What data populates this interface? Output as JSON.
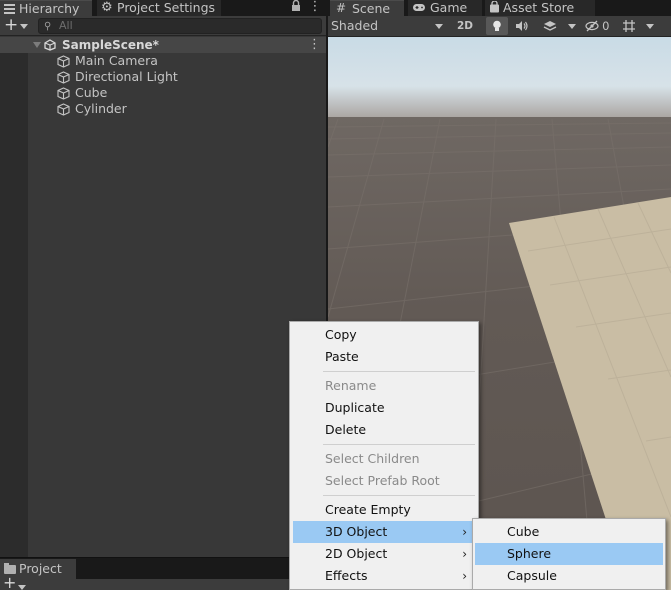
{
  "hierarchy": {
    "tab_label": "Hierarchy",
    "second_tab_label": "Project Settings",
    "search_placeholder": "All",
    "scene": {
      "name": "SampleScene*"
    },
    "objects": [
      {
        "name": "Main Camera"
      },
      {
        "name": "Directional Light"
      },
      {
        "name": "Cube"
      },
      {
        "name": "Cylinder"
      }
    ]
  },
  "project": {
    "tab_label": "Project"
  },
  "scene_view": {
    "tabs": [
      {
        "label": "Scene",
        "icon": "grid-icon"
      },
      {
        "label": "Game",
        "icon": "gamepad-icon"
      },
      {
        "label": "Asset Store",
        "icon": "shopping-bag-icon"
      }
    ],
    "shading_mode": "Shaded",
    "btn_2d": "2D",
    "hidden_count": "0"
  },
  "context_menu": {
    "items": [
      {
        "label": "Copy",
        "enabled": true
      },
      {
        "label": "Paste",
        "enabled": true
      },
      {
        "label": "Rename",
        "enabled": false
      },
      {
        "label": "Duplicate",
        "enabled": true
      },
      {
        "label": "Delete",
        "enabled": true
      },
      {
        "label": "Select Children",
        "enabled": false
      },
      {
        "label": "Select Prefab Root",
        "enabled": false
      },
      {
        "label": "Create Empty",
        "enabled": true
      },
      {
        "label": "3D Object",
        "enabled": true,
        "submenu": true
      },
      {
        "label": "2D Object",
        "enabled": true,
        "submenu": true
      },
      {
        "label": "Effects",
        "enabled": true,
        "submenu": true
      }
    ],
    "highlighted": "3D Object"
  },
  "submenu_3d": {
    "items": [
      {
        "label": "Cube"
      },
      {
        "label": "Sphere"
      },
      {
        "label": "Capsule"
      }
    ],
    "highlighted": "Sphere"
  },
  "colors": {
    "editor_bg": "#383838",
    "menu_bg": "#f0f0f0",
    "menu_highlight": "#9ac9f3",
    "floor_plane": "#c9bda4"
  }
}
